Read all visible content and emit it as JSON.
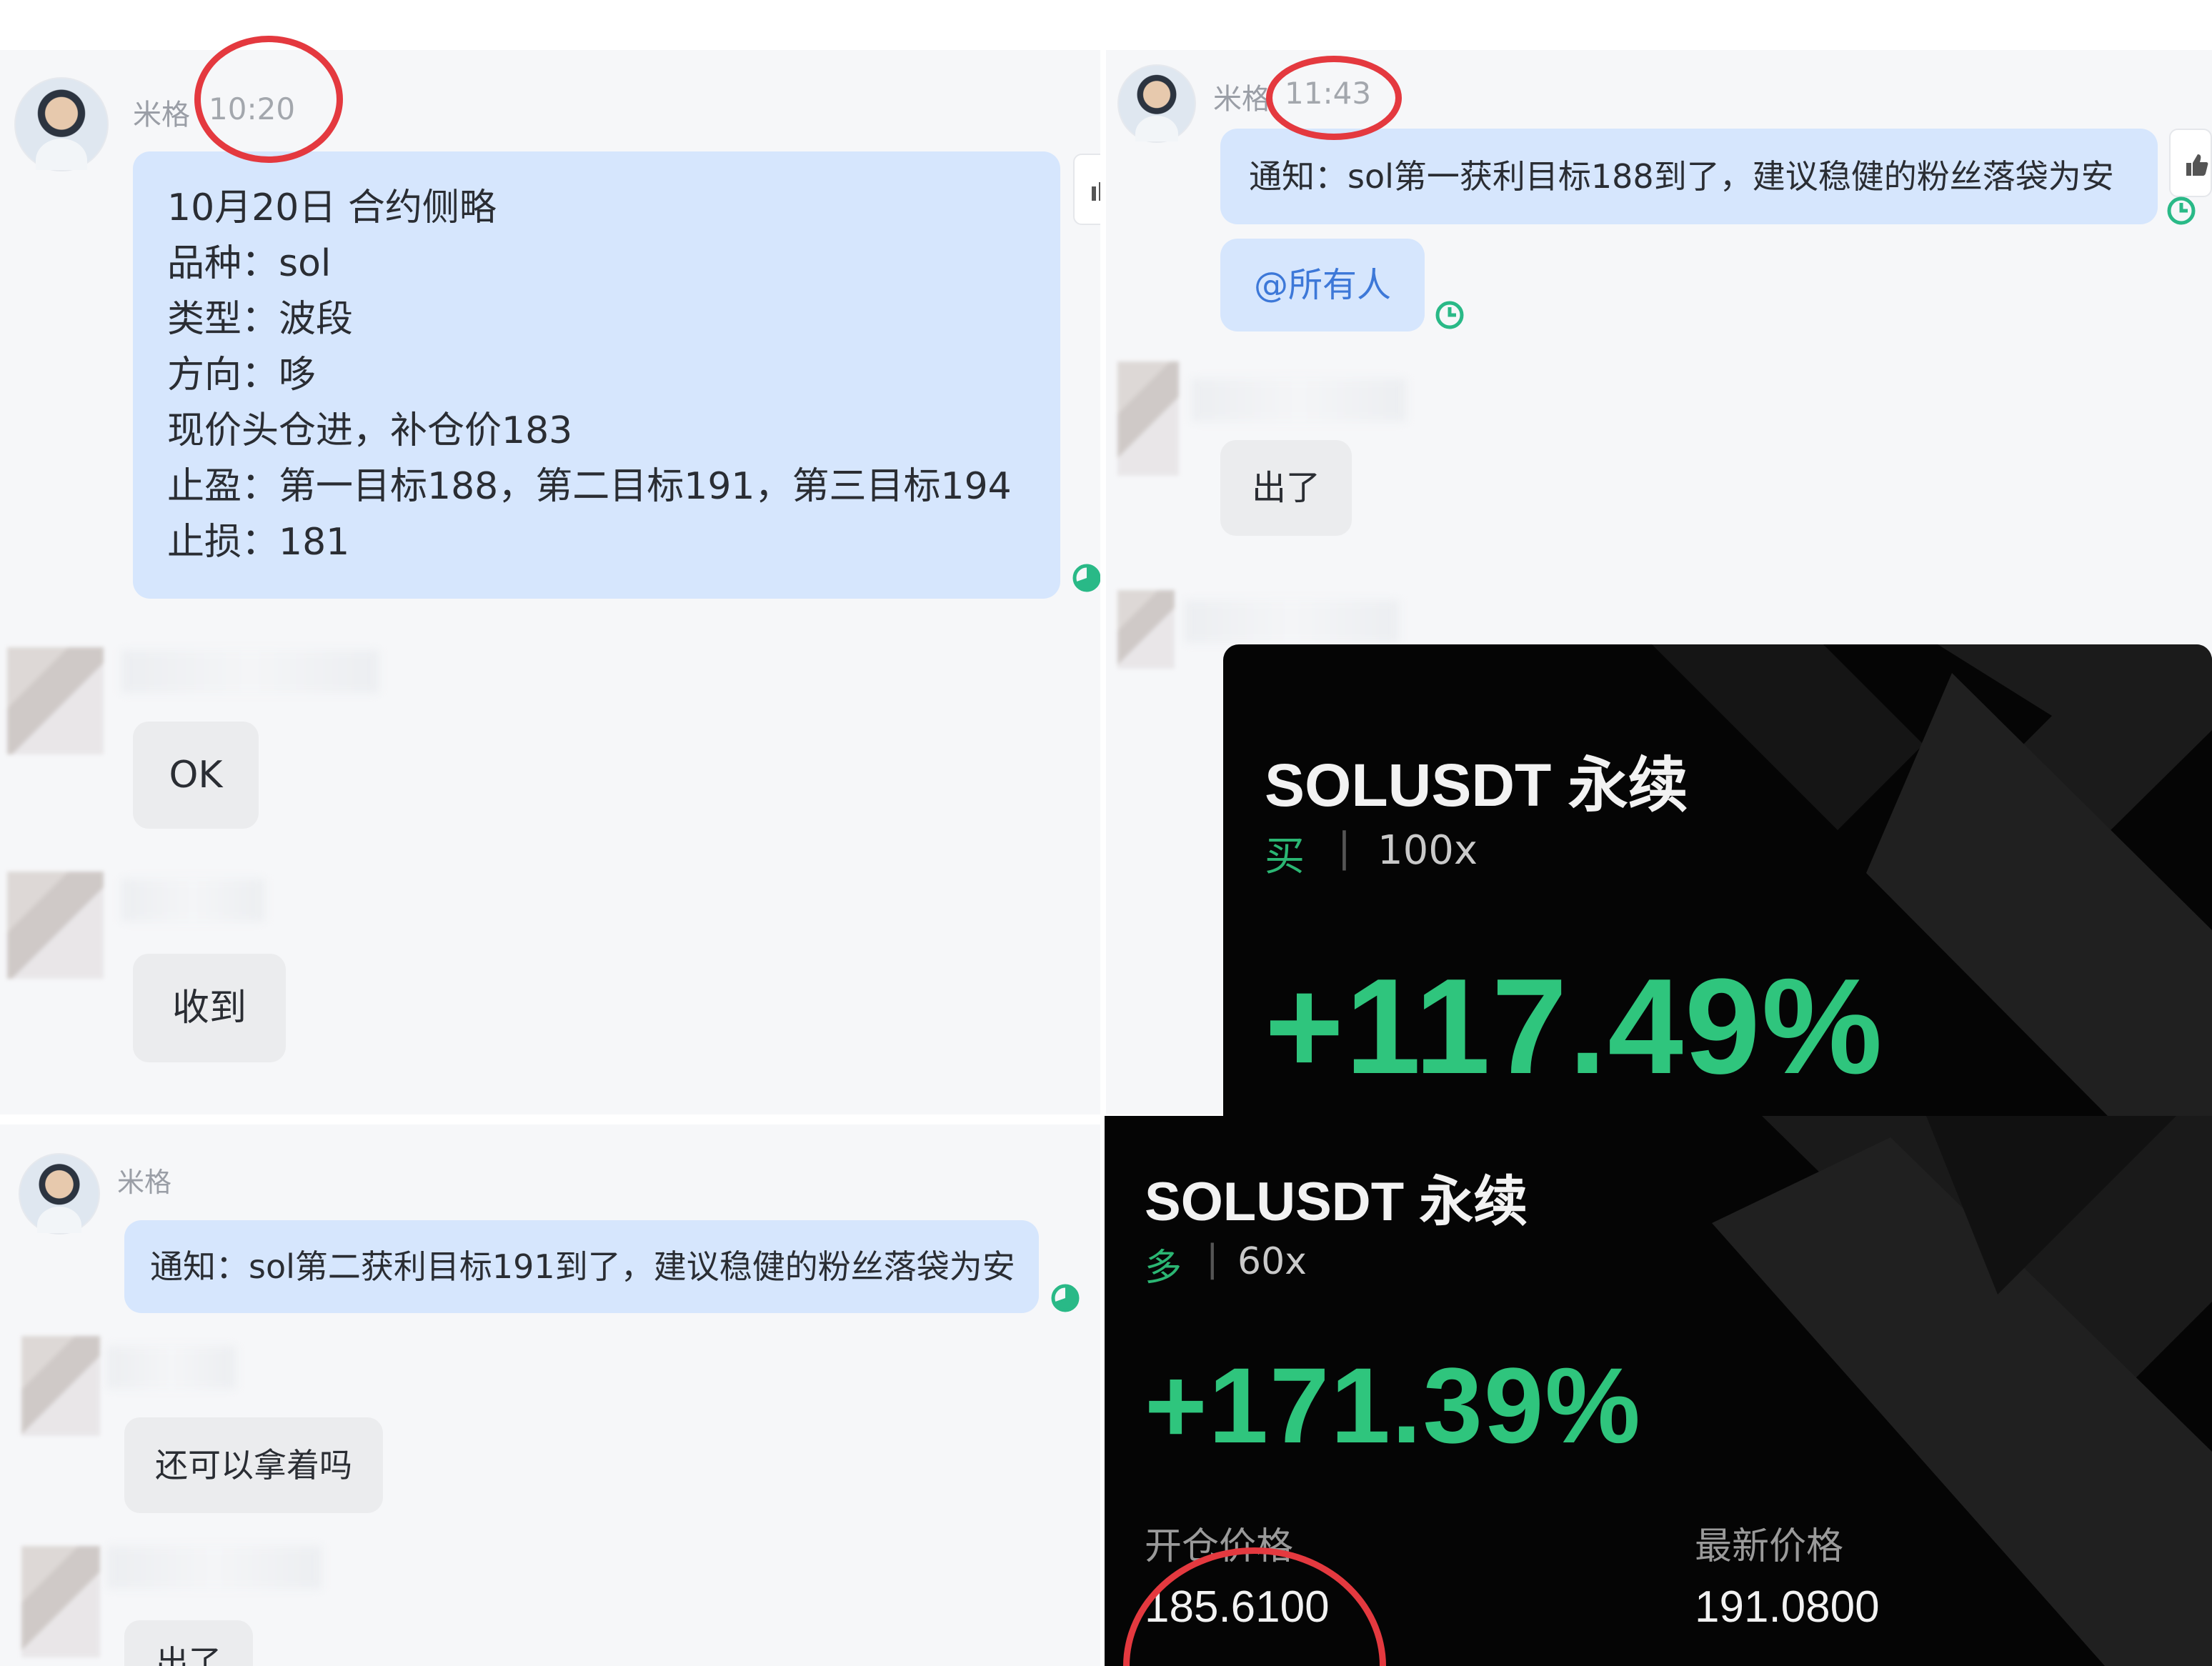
{
  "colors": {
    "bubble_blue": "#d6e6fd",
    "bubble_gray": "#ebecee",
    "profit_green": "#2fc57d",
    "highlight_red": "#e4393f",
    "card_bg": "#050505"
  },
  "top_left": {
    "sender": "米格",
    "time": "10:20",
    "signal_lines": [
      "10月20日 合约侧略",
      "品种：sol",
      "类型：波段",
      "方向：哆",
      "现价头仓进，补仓价183",
      "止盈：第一目标188，第二目标191，第三目标194",
      "止损：181"
    ],
    "reply_1": "OK",
    "reply_2": "收到"
  },
  "top_right": {
    "sender": "米格",
    "time": "11:43",
    "notice": "通知：sol第一获利目标188到了，建议稳健的粉丝落袋为安",
    "mention": "@所有人",
    "reply": "出了",
    "card": {
      "title": "SOLUSDT 永续",
      "side": "买",
      "leverage": "100x",
      "pnl": "+117.49%"
    }
  },
  "bottom_left": {
    "sender": "米格",
    "notice": "通知：sol第二获利目标191到了，建议稳健的粉丝落袋为安",
    "reply_1": "还可以拿着吗",
    "reply_2": "出了"
  },
  "bottom_right": {
    "card": {
      "title": "SOLUSDT 永续",
      "side": "多",
      "leverage": "60x",
      "pnl": "+171.39%",
      "open_price_label": "开仓价格",
      "open_price": "185.6100",
      "latest_price_label": "最新价格",
      "latest_price": "191.0800"
    }
  }
}
